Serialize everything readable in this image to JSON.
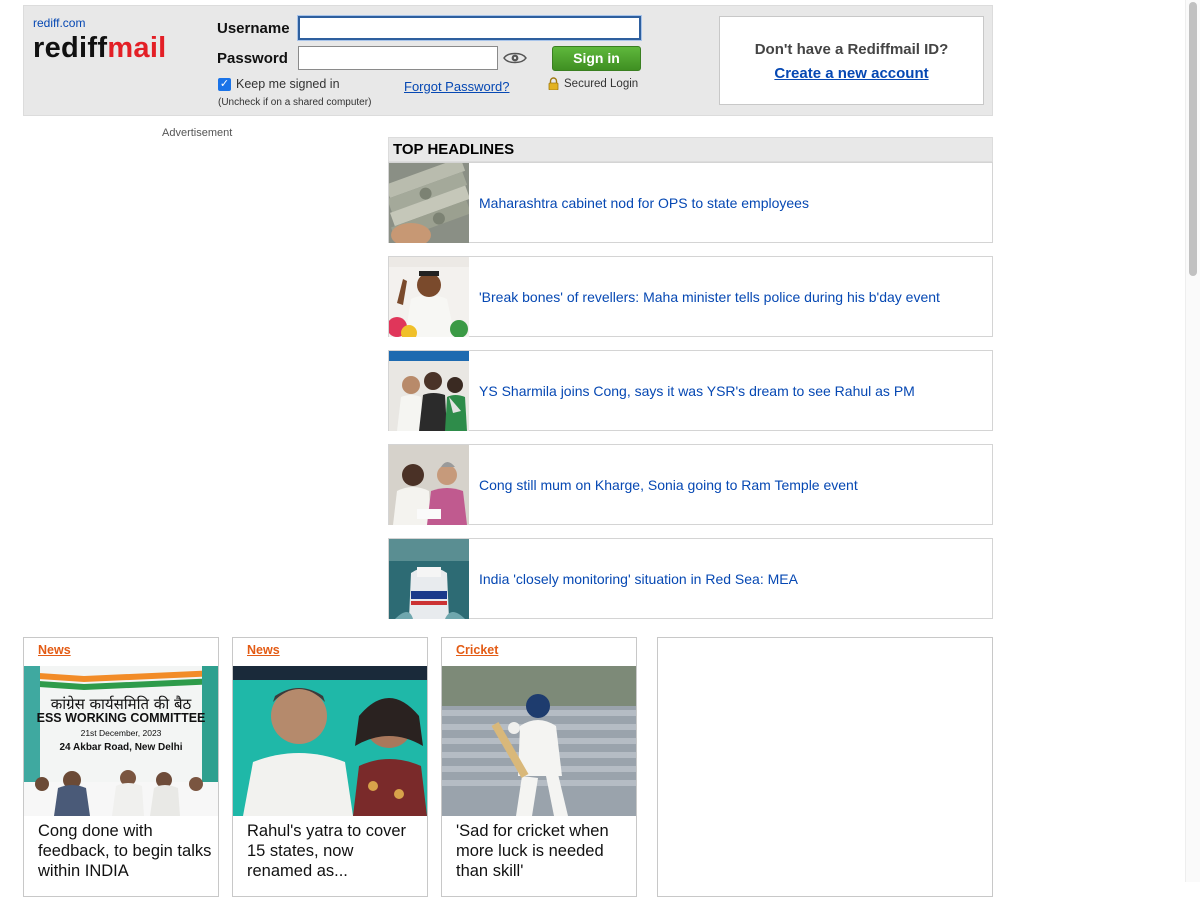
{
  "header": {
    "brand_small": "rediff.com",
    "logo_part1": "rediff",
    "logo_part2": "mail",
    "username_label": "Username",
    "password_label": "Password",
    "username_value": "",
    "password_value": "",
    "signin_label": "Sign in",
    "keep_signed_in_label": "Keep me signed in",
    "keep_signed_in_checked": true,
    "uncheck_note": "(Uncheck if on a shared computer)",
    "forgot_label": "Forgot Password?",
    "secured_label": "Secured Login",
    "signup_question": "Don't have a Rediffmail ID?",
    "signup_link": "Create a new account"
  },
  "ad": {
    "label": "Advertisement"
  },
  "headlines": {
    "title": "TOP HEADLINES",
    "items": [
      {
        "text": "Maharashtra cabinet nod for OPS to state employees",
        "thumb": "currency-notes"
      },
      {
        "text": "'Break bones' of revellers: Maha minister tells police during his b'day event",
        "thumb": "minister-speech"
      },
      {
        "text": "YS Sharmila joins Cong, says it was YSR's dream to see Rahul as PM",
        "thumb": "party-joining"
      },
      {
        "text": "Cong still mum on Kharge, Sonia going to Ram Temple event",
        "thumb": "kharge-sonia"
      },
      {
        "text": "India 'closely monitoring' situation in Red Sea: MEA",
        "thumb": "ship-at-sea"
      }
    ]
  },
  "cards": [
    {
      "category": "News",
      "text": "Cong done with feedback, to begin talks within INDIA",
      "image_caption_hindi": "कांग्रेस कार्यसमिति की बैठ",
      "image_caption_english": "ESS WORKING COMMITTEE",
      "image_date": "21st December, 2023",
      "image_address": "24 Akbar Road, New Delhi"
    },
    {
      "category": "News",
      "text": "Rahul's yatra to cover 15 states, now renamed as..."
    },
    {
      "category": "Cricket",
      "text": "'Sad for cricket when more luck is needed than skill'"
    }
  ],
  "colors": {
    "link_blue": "#0648b3",
    "logo_red": "#e31f26",
    "signin_green": "#4fa52f",
    "category_orange": "#e35b14",
    "header_gray": "#e8e8e8"
  }
}
